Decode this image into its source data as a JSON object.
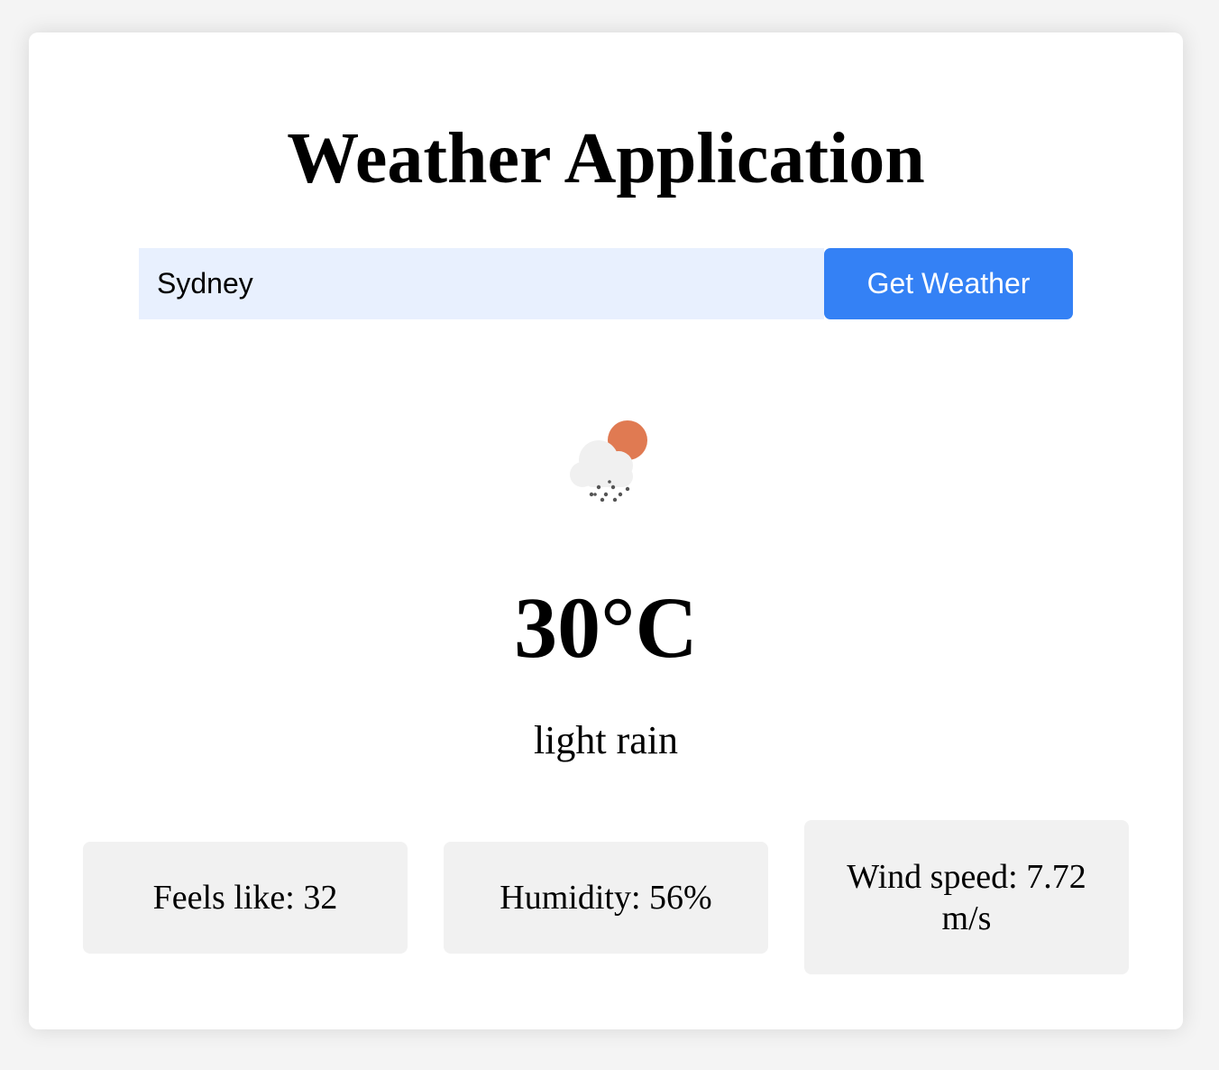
{
  "app": {
    "title": "Weather Application"
  },
  "search": {
    "value": "Sydney",
    "button_label": "Get Weather",
    "button_color": "#3481f5",
    "input_background": "#e8f0fe"
  },
  "weather": {
    "icon": "cloud-sun-rain-icon",
    "temperature": "30°C",
    "description": "light rain"
  },
  "details": {
    "feels_like": "Feels like: 32",
    "humidity": "Humidity: 56%",
    "wind_speed": "Wind speed: 7.72 m/s"
  }
}
